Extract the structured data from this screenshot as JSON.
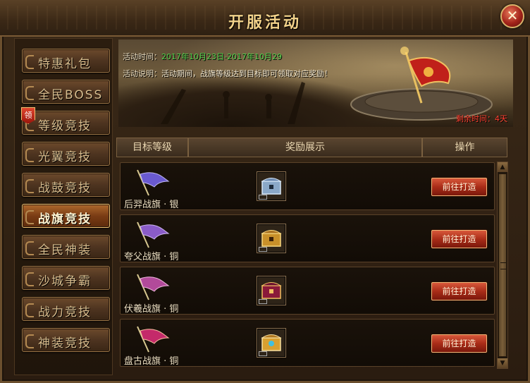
{
  "window": {
    "title": "开服活动"
  },
  "sidebar": {
    "items": [
      {
        "label": "特惠礼包"
      },
      {
        "label": "全民BOSS"
      },
      {
        "label": "等级竞技",
        "badge": "领"
      },
      {
        "label": "光翼竞技"
      },
      {
        "label": "战鼓竞技"
      },
      {
        "label": "战旗竞技",
        "active": true
      },
      {
        "label": "全民神装"
      },
      {
        "label": "沙城争霸"
      },
      {
        "label": "战力竞技"
      },
      {
        "label": "神装竞技"
      }
    ]
  },
  "banner": {
    "time_label": "活动时间：",
    "time_value": "2017年10月23日-2017年10月29",
    "desc_label": "活动说明：",
    "desc_value": "活动期间，战旗等级达到目标即可领取对应奖励！",
    "remain_label": "剩余时间：",
    "remain_value": "4天"
  },
  "table": {
    "headers": [
      "目标等级",
      "奖励展示",
      "操作"
    ],
    "rows": [
      {
        "name": "后羿战旗 · 银",
        "action": "前往打造",
        "flag_color": "#6a5ad0",
        "chest": "silver-chest-icon"
      },
      {
        "name": "夸父战旗 · 铜",
        "action": "前往打造",
        "flag_color": "#8a5cc8",
        "chest": "gold-chest-icon"
      },
      {
        "name": "伏羲战旗 · 铜",
        "action": "前往打造",
        "flag_color": "#b24a9a",
        "chest": "ornate-chest-icon"
      },
      {
        "name": "盘古战旗 · 铜",
        "action": "前往打造",
        "flag_color": "#c42a6a",
        "chest": "jewel-chest-icon"
      }
    ]
  },
  "colors": {
    "accent": "#f2d28a",
    "green": "#4fd24a",
    "red": "#ff4030",
    "button": "#a92c18"
  }
}
